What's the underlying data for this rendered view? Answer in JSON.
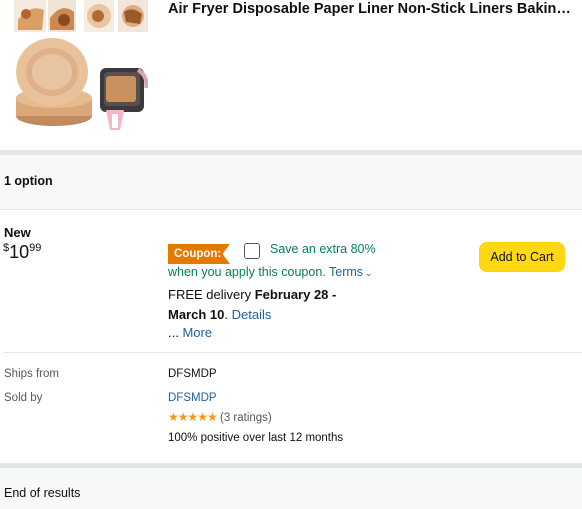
{
  "product": {
    "title": "Air Fryer Disposable Paper Liner Non-Stick Liners Baking f..."
  },
  "options": {
    "count_label": "1 option"
  },
  "offer": {
    "condition": "New",
    "price_symbol": "$",
    "price_whole": "10",
    "price_fraction": "99",
    "coupon_badge": "Coupon:",
    "coupon_save": "Save an extra 80%",
    "coupon_apply": "when you apply this coupon.",
    "terms_label": "Terms",
    "delivery_prefix": "FREE delivery ",
    "delivery_dates_1": "February 28 -",
    "delivery_dates_2": "March 10",
    "delivery_sep": ". ",
    "details_link": "Details",
    "more_prefix": "... ",
    "more_link": "More",
    "add_to_cart": "Add to Cart"
  },
  "seller": {
    "ships_from_label": "Ships from",
    "ships_from_value": "DFSMDP",
    "sold_by_label": "Sold by",
    "sold_by_value": "DFSMDP",
    "stars": "★★★★★",
    "ratings": "(3 ratings)",
    "positive": "100% positive over last 12 months"
  },
  "footer": {
    "end_label": "End of results"
  },
  "colors": {
    "accent_button": "#ffd814",
    "coupon_badge": "#e67a00",
    "coupon_text": "#067d62",
    "link": "#2162a1",
    "star": "#f29a16"
  }
}
